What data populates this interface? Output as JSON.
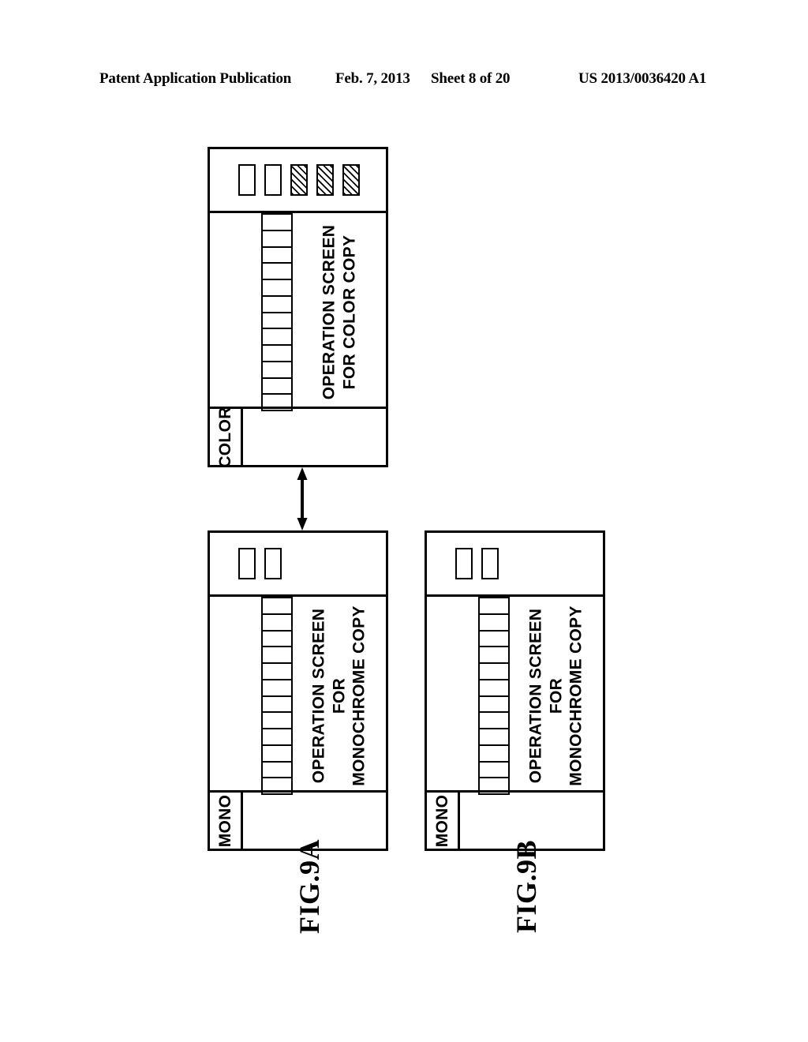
{
  "header": {
    "publication": "Patent Application Publication",
    "date": "Feb. 7, 2013",
    "sheet": "Sheet 8 of 20",
    "publication_number": "US 2013/0036420 A1"
  },
  "colors": {
    "ink": "#000000",
    "paper": "#ffffff"
  },
  "figures": [
    {
      "id": "fig-9a-color-panel",
      "caption": "",
      "tab_label": "COLOR",
      "screen_caption_lines": [
        "OPERATION SCREEN",
        "FOR COLOR COPY"
      ],
      "ladder_cells": 12,
      "keys": [
        {
          "style": "plain"
        },
        {
          "style": "plain"
        },
        {
          "style": "hatched"
        },
        {
          "style": "hatched"
        },
        {
          "style": "hatched"
        }
      ],
      "key_count": 5,
      "hatched_key_count": 3,
      "plain_key_count": 2
    },
    {
      "id": "fig-9a-mono-panel",
      "caption": "FIG.9A",
      "tab_label": "MONO",
      "screen_caption_lines": [
        "OPERATION SCREEN",
        "FOR",
        "MONOCHROME COPY"
      ],
      "ladder_cells": 12,
      "keys": [
        {
          "style": "plain"
        },
        {
          "style": "plain"
        }
      ],
      "key_count": 2,
      "hatched_key_count": 0,
      "plain_key_count": 2
    },
    {
      "id": "fig-9b-mono-panel",
      "caption": "FIG.9B",
      "tab_label": "MONO",
      "screen_caption_lines": [
        "OPERATION SCREEN",
        "FOR",
        "MONOCHROME COPY"
      ],
      "ladder_cells": 12,
      "keys": [
        {
          "style": "plain"
        },
        {
          "style": "plain"
        }
      ],
      "key_count": 2,
      "hatched_key_count": 0,
      "plain_key_count": 2
    }
  ],
  "connector": {
    "name": "double-headed-arrow",
    "from": "fig-9a-color-panel",
    "to": "fig-9a-mono-panel"
  }
}
